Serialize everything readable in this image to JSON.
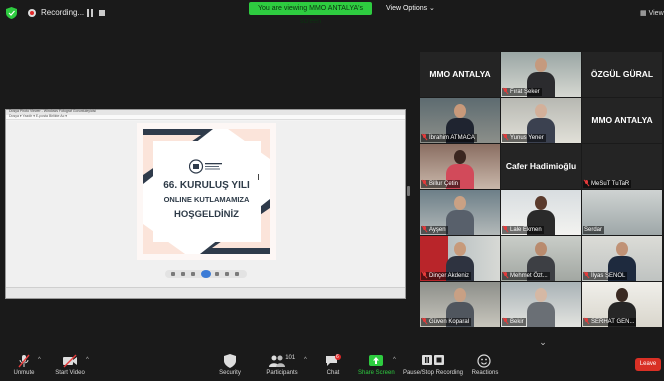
{
  "top_bar": {
    "recording_label": "Recording...",
    "banner": "You are viewing MMO ANTALYA's screen",
    "view_options": "View Options ⌄",
    "view_label": "View",
    "recording_colors": {
      "banner_bg": "#2ecc40",
      "dot": "#e02828"
    }
  },
  "shared_screen": {
    "window_title": "Dosya Photo Viewer - Windows Fotograf Goruntuleyicisi",
    "menu": "Dosya ▾  Yazdir ▾  E-posta  Birlikte Ac ▾",
    "slide": {
      "line1": "66. KURULUŞ YILI",
      "line2": "ONLINE KUTLAMAMIZA",
      "line3": "HOŞGELDİNİZ"
    }
  },
  "gallery": {
    "participants": [
      {
        "name": "MMO ANTALYA",
        "type": "label",
        "muted": false
      },
      {
        "name": "Fırat Şeker",
        "type": "video",
        "muted": true
      },
      {
        "name": "ÖZGÜL GÜRAL",
        "type": "label",
        "muted": false
      },
      {
        "name": "İbrahim ATMACA",
        "type": "video",
        "muted": true,
        "active": true
      },
      {
        "name": "Yunus Yener",
        "type": "video",
        "muted": true
      },
      {
        "name": "MMO ANTALYA",
        "type": "label",
        "muted": false
      },
      {
        "name": "Billur Çetin",
        "type": "video",
        "muted": true
      },
      {
        "name": "Cafer Hadimioğlu",
        "type": "label",
        "muted": false
      },
      {
        "name": "MeSuT TuTaR",
        "type": "blank",
        "muted": true
      },
      {
        "name": "Ayşen",
        "type": "video",
        "muted": true
      },
      {
        "name": "Lale Ekmen",
        "type": "video",
        "muted": true
      },
      {
        "name": "Serdar",
        "type": "video",
        "muted": false
      },
      {
        "name": "Dinçer Akdeniz",
        "type": "video",
        "muted": true
      },
      {
        "name": "Mehmet Özt...",
        "type": "video",
        "muted": true
      },
      {
        "name": "İlyas ŞENOL",
        "type": "video",
        "muted": true
      },
      {
        "name": "Güven Koparal",
        "type": "video",
        "muted": true
      },
      {
        "name": "Bekir",
        "type": "video",
        "muted": true
      },
      {
        "name": "SERHAT GEN...",
        "type": "video",
        "muted": true
      }
    ]
  },
  "toolbar": {
    "unmute": "Unmute",
    "start_video": "Start Video",
    "security": "Security",
    "participants": "Participants",
    "participants_count": "101",
    "chat": "Chat",
    "chat_badge": "6",
    "share_screen": "Share Screen",
    "pause_recording": "Pause/Stop Recording",
    "reactions": "Reactions",
    "leave": "Leave",
    "colors": {
      "share": "#2ecc40",
      "leave": "#d93025"
    }
  }
}
